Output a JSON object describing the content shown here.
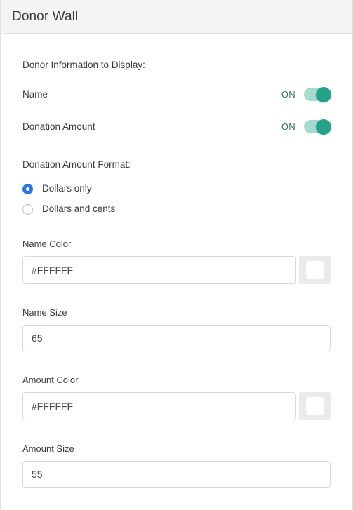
{
  "header": {
    "title": "Donor Wall"
  },
  "display_section": {
    "label": "Donor Information to Display:",
    "toggles": [
      {
        "label": "Name",
        "state": "ON",
        "on": true
      },
      {
        "label": "Donation Amount",
        "state": "ON",
        "on": true
      }
    ]
  },
  "format_section": {
    "label": "Donation Amount Format:",
    "options": [
      {
        "label": "Dollars only",
        "selected": true
      },
      {
        "label": "Dollars and cents",
        "selected": false
      }
    ]
  },
  "fields": {
    "name_color": {
      "label": "Name Color",
      "value": "#FFFFFF",
      "placeholder": "#FFFFFF",
      "swatch": "#FFFFFF"
    },
    "name_size": {
      "label": "Name Size",
      "value": "65",
      "placeholder": "65"
    },
    "amount_color": {
      "label": "Amount Color",
      "value": "#FFFFFF",
      "placeholder": "#FFFFFF",
      "swatch": "#FFFFFF"
    },
    "amount_size": {
      "label": "Amount Size",
      "value": "55",
      "placeholder": "55"
    }
  },
  "colors": {
    "toggle_on_track": "#a5dcce",
    "toggle_on_knob": "#25a38a",
    "toggle_on_text": "#2b7a4f",
    "radio_selected": "#2d76e8",
    "header_bg": "#f4f4f4"
  }
}
